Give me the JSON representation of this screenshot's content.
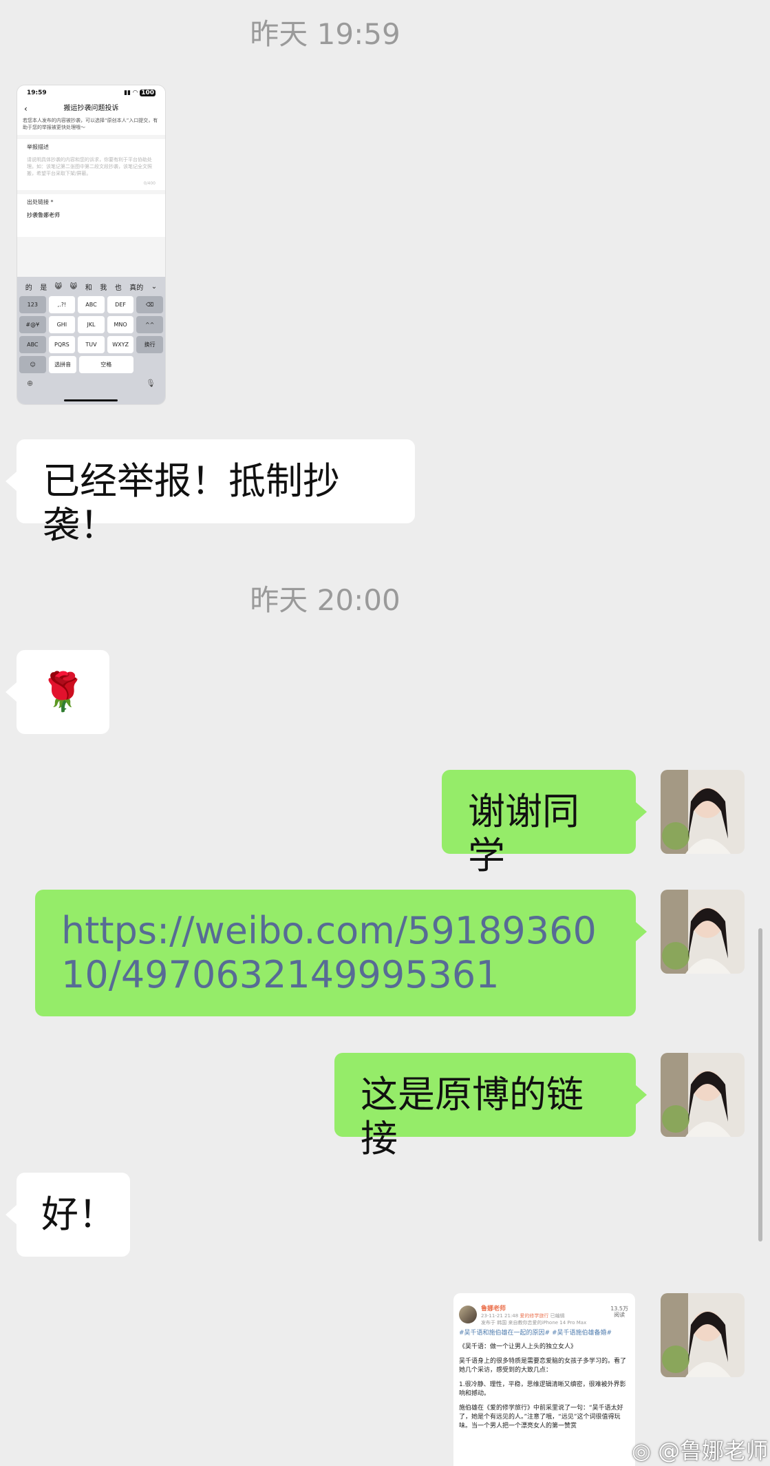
{
  "chat": {
    "timestamps": [
      "昨天 19:59",
      "昨天 20:00"
    ],
    "messages": {
      "m_reported": "已经举报！抵制抄袭！",
      "m_rose": "🌹",
      "m_thanks": "谢谢同学",
      "m_link": "https://weibo.com/5918936010/4970632149995361",
      "m_this_is": "这是原博的链接",
      "m_ok": "好！"
    }
  },
  "screenshot": {
    "time": "19:59",
    "battery": "100",
    "title": "搬运抄袭问题投诉",
    "hint": "若您本人发布的内容被抄袭，可以选择“原创本人”入口提交，有助于您的举报被更快处理哦～",
    "desc_label": "举报描述",
    "desc_placeholder": "请说明具体抄袭的内容和您的诉求，你要有利于平台协助处理。如：该笔记第二张图中第二段文段抄袭，该笔记全文照搬，希望平台采取下架/屏蔽。",
    "counter": "0/400",
    "link_label": "出处链接 *",
    "link_value": "抄袭鲁娜老师",
    "candidates": [
      "的",
      "是",
      "😸",
      "😸",
      "和",
      "我",
      "也",
      "真的"
    ],
    "kb_row1": [
      "123",
      ",.?!",
      "ABC",
      "DEF",
      "⌫"
    ],
    "kb_row2": [
      "#@¥",
      "GHI",
      "JKL",
      "MNO",
      "^^"
    ],
    "kb_row3": [
      "ABC",
      "PQRS",
      "TUV",
      "WXYZ",
      "换行"
    ],
    "kb_row4": [
      "☺",
      "选拼音",
      "空格"
    ]
  },
  "weibo_preview": {
    "user": "鲁娜老师",
    "time": "23-11-21 21:48",
    "topic": "爱的修学旅行",
    "edited": "已编辑",
    "source": "发布于 韩国  来自教你恋爱的iPhone 14 Pro Max",
    "stat_value": "13.5万",
    "stat_label": "阅读",
    "tags": "#吴千语和施伯雄在一起的原因# #吴千语施伯雄备婚#",
    "para1": "《吴千语：做一个让男人上头的独立女人》",
    "para2": "吴千语身上的很多特质是需要恋爱脑的女孩子多学习的。看了她几个采访，感受到的大致几点：",
    "para3": "1.很冷静、理性，平稳，思维逻辑清晰又缜密，很难被外界影响和撼动。",
    "para4": "施伯雄在《爱的修学旅行》中前采里说了一句：“吴千语太好了，她是个有远见的人。”注意了哦，“远见”这个词很值得玩味。当一个男人把一个漂亮女人的第一赞赏"
  },
  "watermark": "@鲁娜老师"
}
